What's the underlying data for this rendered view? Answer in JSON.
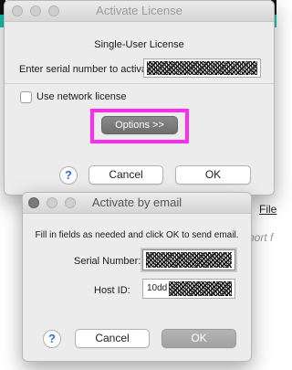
{
  "activate_license": {
    "title": "Activate License",
    "heading": "Single-User License",
    "serial_label": "Enter serial number to activate",
    "use_network_label": "Use network license",
    "options_button": "Options >>",
    "help_icon": "?",
    "cancel_button": "Cancel",
    "ok_button": "OK"
  },
  "activate_email": {
    "title": "Activate by email",
    "instructions": "Fill in fields as needed and click OK to send email.",
    "serial_label": "Serial Number:",
    "host_id_label": "Host ID:",
    "host_id_prefix": "10dd",
    "help_icon": "?",
    "cancel_button": "Cancel",
    "ok_button": "OK"
  },
  "background": {
    "link_fragment": "File",
    "text_fragment": "nort f"
  },
  "colors": {
    "highlight": "#ff2bf0",
    "accent_teal": "#17c3b2",
    "help_blue": "#2a6fd6"
  }
}
